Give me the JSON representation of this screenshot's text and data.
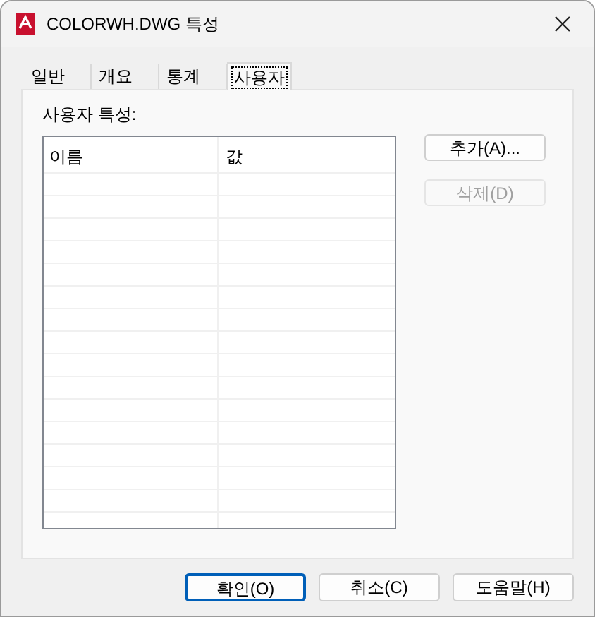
{
  "window": {
    "title": "COLORWH.DWG 특성"
  },
  "tabs": [
    {
      "label": "일반",
      "selected": false
    },
    {
      "label": "개요",
      "selected": false
    },
    {
      "label": "통계",
      "selected": false
    },
    {
      "label": "사용자",
      "selected": true
    }
  ],
  "section_label": "사용자 특성:",
  "table": {
    "columns": [
      "이름",
      "값"
    ]
  },
  "side_buttons": [
    {
      "label": "추가(A)...",
      "disabled": false
    },
    {
      "label": "삭제(D)",
      "disabled": true
    }
  ],
  "buttons": [
    {
      "label": "확인(O)",
      "default": true
    },
    {
      "label": "취소(C)",
      "default": false
    },
    {
      "label": "도움말(H)",
      "default": false
    }
  ]
}
